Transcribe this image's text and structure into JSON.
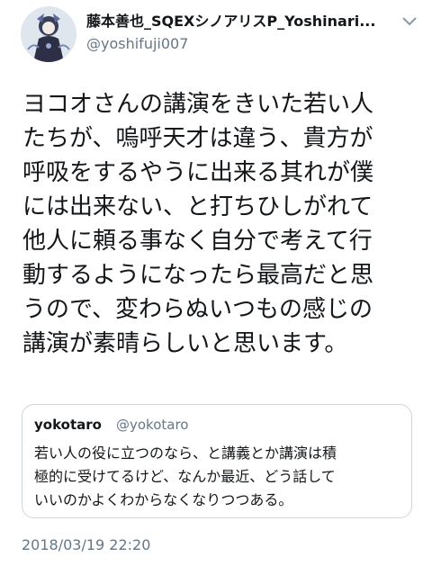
{
  "author": {
    "display_name": "藤本善也_SQEXシノアリスP_Yoshinari...",
    "handle": "@yoshifuji007"
  },
  "icons": {
    "menu": "chevron-down-icon",
    "avatar": "avatar"
  },
  "tweet": {
    "lines": [
      "ヨコオさんの講演をきいた若い人",
      "たちが、嗚呼天才は違う、貴方が",
      "呼吸をするやうに出来る其れが僕",
      "には出来ない、と打ちひしがれて",
      "他人に頼る事なく自分で考えて行",
      "動するようになったら最高だと思",
      "うので、変わらぬいつもの感じの",
      "講演が素晴らしいと思います。"
    ],
    "timestamp": "2018/03/19 22:20"
  },
  "quoted_tweet": {
    "display_name": "yokotaro",
    "handle": "@yokotaro",
    "lines": [
      "若い人の役に立つのなら、と講義とか講演は積",
      "極的に受けてるけど、なんか最近、どう話して",
      "いいのかよくわからなくなりつつある。"
    ]
  },
  "colors": {
    "text": "#14171a",
    "secondary": "#657786",
    "border": "#ccd6dd"
  }
}
